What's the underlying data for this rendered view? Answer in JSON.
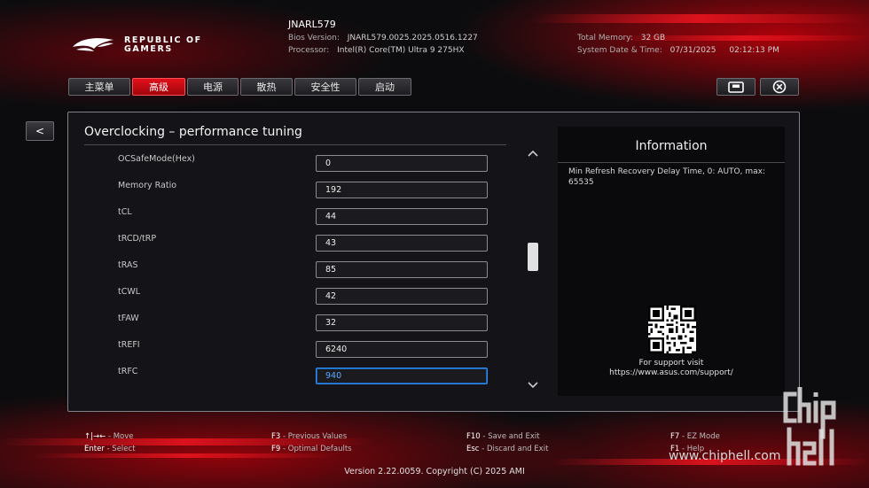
{
  "header": {
    "model": "JNARL579",
    "logo_text": [
      "REPUBLIC OF",
      "GAMERS"
    ],
    "bios_version_label": "Bios Version:",
    "bios_version": "JNARL579.0025.2025.0516.1227",
    "processor_label": "Processor:",
    "processor": "Intel(R) Core(TM) Ultra 9 275HX",
    "total_memory_label": "Total Memory:",
    "total_memory": "32 GB",
    "datetime_label": "System Date & Time:",
    "date": "07/31/2025",
    "time": "02:12:13 PM"
  },
  "tabs": [
    {
      "label": "主菜单",
      "active": false
    },
    {
      "label": "高级",
      "active": true
    },
    {
      "label": "电源",
      "active": false
    },
    {
      "label": "散热",
      "active": false
    },
    {
      "label": "安全性",
      "active": false
    },
    {
      "label": "启动",
      "active": false
    }
  ],
  "toolbar": {
    "save_icon": "save-icon",
    "exit_icon": "close-circle-icon"
  },
  "back_label": "<",
  "section_title": "Overclocking – performance tuning",
  "settings": [
    {
      "label": "OCSafeMode(Hex)",
      "value": "0"
    },
    {
      "label": "Memory Ratio",
      "value": "192"
    },
    {
      "label": "tCL",
      "value": "44"
    },
    {
      "label": "tRCD/tRP",
      "value": "43"
    },
    {
      "label": "tRAS",
      "value": "85"
    },
    {
      "label": "tCWL",
      "value": "42"
    },
    {
      "label": "tFAW",
      "value": "32"
    },
    {
      "label": "tREFI",
      "value": "6240"
    },
    {
      "label": "tRFC",
      "value": "940",
      "selected": true
    }
  ],
  "scroll": {
    "up": "^",
    "down": "v"
  },
  "info": {
    "title": "Information",
    "description": "Min Refresh Recovery Delay Time, 0: AUTO, max: 65535",
    "support_line1": "For support visit",
    "support_line2": "https://www.asus.com/support/"
  },
  "help": {
    "move_keys": "↑|→←",
    "move": "- Move",
    "enter_key": "Enter",
    "select": "- Select",
    "f3_key": "F3",
    "f3": "- Previous Values",
    "f9_key": "F9",
    "f9": "- Optimal Defaults",
    "f10_key": "F10",
    "f10": "- Save and Exit",
    "esc_key": "Esc",
    "esc": "- Discard and Exit",
    "f7_key": "F7",
    "f7": "- EZ Mode",
    "f1_key": "F1",
    "f1": "- Help"
  },
  "version": "Version 2.22.0059. Copyright (C) 2025 AMI",
  "watermark": "www.chiphell.com",
  "colors": {
    "accent": "#e2101a",
    "selected_border": "#2f8ff0"
  }
}
